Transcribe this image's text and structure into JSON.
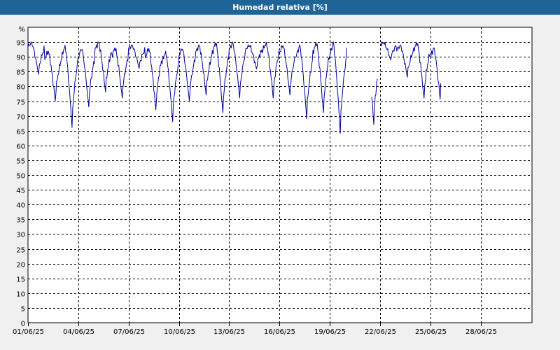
{
  "window": {
    "title": "Humedad relativa [%]"
  },
  "chart_data": {
    "type": "line",
    "title": "Humedad relativa [%]",
    "ylabel": "%",
    "xlabel": "",
    "ylim": [
      0,
      100
    ],
    "yticks": [
      0,
      5,
      10,
      15,
      20,
      25,
      30,
      35,
      40,
      45,
      50,
      55,
      60,
      65,
      70,
      75,
      80,
      85,
      90,
      95
    ],
    "xlim": [
      0,
      31
    ],
    "xticks": [
      {
        "day": 0,
        "label": "01/06/25"
      },
      {
        "day": 3,
        "label": "04/06/25"
      },
      {
        "day": 6,
        "label": "07/06/25"
      },
      {
        "day": 9,
        "label": "10/06/25"
      },
      {
        "day": 12,
        "label": "13/06/25"
      },
      {
        "day": 15,
        "label": "16/06/25"
      },
      {
        "day": 18,
        "label": "19/06/25"
      },
      {
        "day": 21,
        "label": "22/06/25"
      },
      {
        "day": 24,
        "label": "25/06/25"
      },
      {
        "day": 27,
        "label": "28/06/25"
      }
    ],
    "grid": true,
    "colors": {
      "line": "#000099",
      "grid": "#000000",
      "background": "#ffffff"
    },
    "daily_min": [
      84,
      75,
      66,
      73,
      78,
      76,
      86,
      72,
      68,
      75,
      77,
      71,
      76,
      86,
      76,
      77,
      69,
      71,
      64,
      92,
      67,
      89,
      83,
      76,
      73
    ],
    "daily_max": [
      95,
      92,
      94,
      93,
      95,
      93,
      94,
      93,
      92,
      93,
      94,
      95,
      95,
      94,
      95,
      94,
      94,
      95,
      95,
      93,
      93,
      95,
      94,
      95,
      93
    ],
    "gaps": [
      [
        19.0,
        20.5
      ],
      [
        20.85,
        21.0
      ]
    ],
    "series": [
      {
        "values": []
      }
    ],
    "last_value": 81
  }
}
